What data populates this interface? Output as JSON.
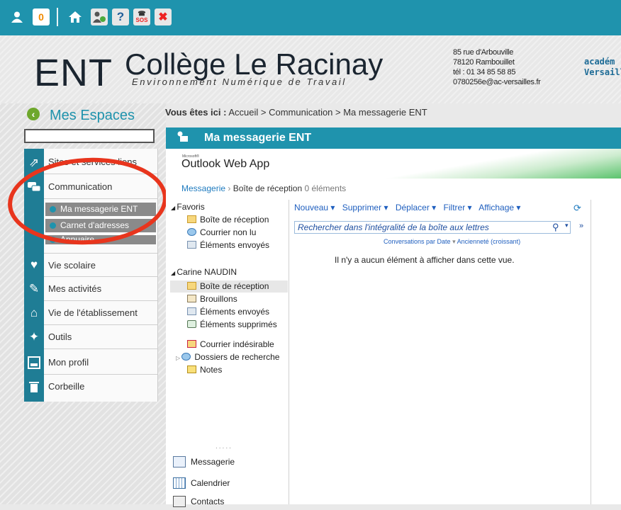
{
  "toolbar": {
    "items": [
      {
        "name": "user-icon",
        "label": ""
      },
      {
        "name": "notifications-badge",
        "label": "0"
      },
      {
        "name": "home-icon",
        "label": ""
      },
      {
        "name": "users-icon",
        "label": ""
      },
      {
        "name": "help-icon",
        "label": "?"
      },
      {
        "name": "sos-icon",
        "label": "SOS"
      },
      {
        "name": "close-icon",
        "label": "✖"
      }
    ],
    "accent": "#1f93ad"
  },
  "header": {
    "ent": "ENT",
    "college": "Collège Le Racinay",
    "subtitle": "Environnement Numérique de Travail",
    "address": [
      "85 rue d'Arbouville",
      "78120 Rambouillet",
      "tél : 01 34 85 58 85",
      "0780256e@ac-versailles.fr"
    ],
    "academie": [
      "académ",
      "Versaill"
    ]
  },
  "sidebar": {
    "title": "Mes Espaces",
    "items": [
      {
        "label": "Sites et services liens",
        "icon": "link-icon"
      },
      {
        "label": "Communication",
        "icon": "chat-icon"
      },
      {
        "label": "Vie scolaire",
        "icon": "heart-icon"
      },
      {
        "label": "Mes activités",
        "icon": "edit-icon"
      },
      {
        "label": "Vie de l'établissement",
        "icon": "home-icon"
      },
      {
        "label": "Outils",
        "icon": "wrench-icon"
      },
      {
        "label": "Mon profil",
        "icon": "profile-icon"
      },
      {
        "label": "Corbeille",
        "icon": "trash-icon"
      }
    ],
    "sub_items": [
      "Ma messagerie ENT",
      "Carnet d'adresses",
      "Annuaire"
    ]
  },
  "breadcrumb": {
    "prefix": "Vous êtes ici :",
    "path": "Accueil > Communication > Ma messagerie ENT"
  },
  "main": {
    "title": "Ma messagerie ENT"
  },
  "owa": {
    "ms_label": "Microsoft®",
    "title": "Outlook Web App",
    "bc_link": "Messagerie",
    "bc_sep": "›",
    "bc_current": "Boîte de réception",
    "bc_count": "0 éléments",
    "favorites_title": "Favoris",
    "favorites": [
      "Boîte de réception",
      "Courrier non lu",
      "Éléments envoyés"
    ],
    "account": "Carine NAUDIN",
    "folders": [
      "Boîte de réception",
      "Brouillons",
      "Éléments envoyés",
      "Éléments supprimés",
      "Courrier indésirable",
      "Dossiers de recherche",
      "Notes"
    ],
    "actions": [
      "Nouveau ▾",
      "Supprimer ▾",
      "Déplacer ▾",
      "Filtrer ▾",
      "Affichage ▾"
    ],
    "search_placeholder": "Rechercher dans l'intégralité de la boîte aux lettres",
    "sort_by": "Conversations par Date",
    "sort_order": "Ancienneté (croissant)",
    "empty": "Il n'y a aucun élément à afficher dans cette vue.",
    "dots": ".....",
    "bottom_nav": [
      "Messagerie",
      "Calendrier",
      "Contacts"
    ]
  }
}
